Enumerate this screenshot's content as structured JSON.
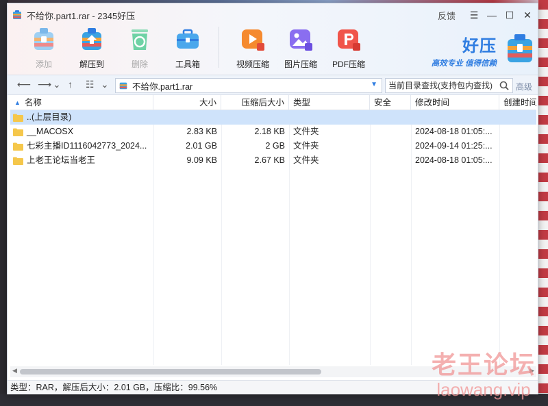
{
  "window": {
    "title": "不给你.part1.rar - 2345好压",
    "feedback_label": "反馈"
  },
  "toolbar": {
    "items": [
      {
        "label": "添加",
        "icon": "add-archive-icon",
        "enabled": false
      },
      {
        "label": "解压到",
        "icon": "extract-icon",
        "enabled": true
      },
      {
        "label": "删除",
        "icon": "recycle-icon",
        "enabled": false
      },
      {
        "label": "工具箱",
        "icon": "toolbox-icon",
        "enabled": true
      },
      {
        "label": "视频压缩",
        "icon": "video-compress-icon",
        "enabled": true
      },
      {
        "label": "图片压缩",
        "icon": "image-compress-icon",
        "enabled": true
      },
      {
        "label": "PDF压缩",
        "icon": "pdf-compress-icon",
        "enabled": true
      }
    ]
  },
  "brand": {
    "name": "好压",
    "slogan": "高效专业 值得信赖"
  },
  "address": {
    "path": "不给你.part1.rar",
    "search_placeholder": "当前目录查找(支持包内查找)",
    "advanced_label": "高级"
  },
  "table": {
    "columns": [
      "名称",
      "大小",
      "压缩后大小",
      "类型",
      "安全",
      "修改时间",
      "创建时间"
    ],
    "rows": [
      {
        "name": "..(上层目录)",
        "size": "",
        "packed": "",
        "type": "",
        "security": "",
        "modified": "",
        "created": "",
        "selected": true
      },
      {
        "name": "__MACOSX",
        "size": "2.83 KB",
        "packed": "2.18 KB",
        "type": "文件夹",
        "security": "",
        "modified": "2024-08-18 01:05:...",
        "created": ""
      },
      {
        "name": "七彩主播ID1116042773_2024...",
        "size": "2.01 GB",
        "packed": "2 GB",
        "type": "文件夹",
        "security": "",
        "modified": "2024-09-14 01:25:...",
        "created": ""
      },
      {
        "name": "上老王论坛当老王",
        "size": "9.09 KB",
        "packed": "2.67 KB",
        "type": "文件夹",
        "security": "",
        "modified": "2024-08-18 01:05:...",
        "created": ""
      }
    ]
  },
  "status": {
    "text": "类型：RAR，解压后大小：2.01 GB，压缩比：99.56%"
  },
  "watermark": {
    "line1": "老王论坛",
    "line2": "laowang.vip"
  },
  "colors": {
    "accent": "#2f7de1",
    "selection": "#cfe3fb",
    "folder": "#f5c74b"
  }
}
